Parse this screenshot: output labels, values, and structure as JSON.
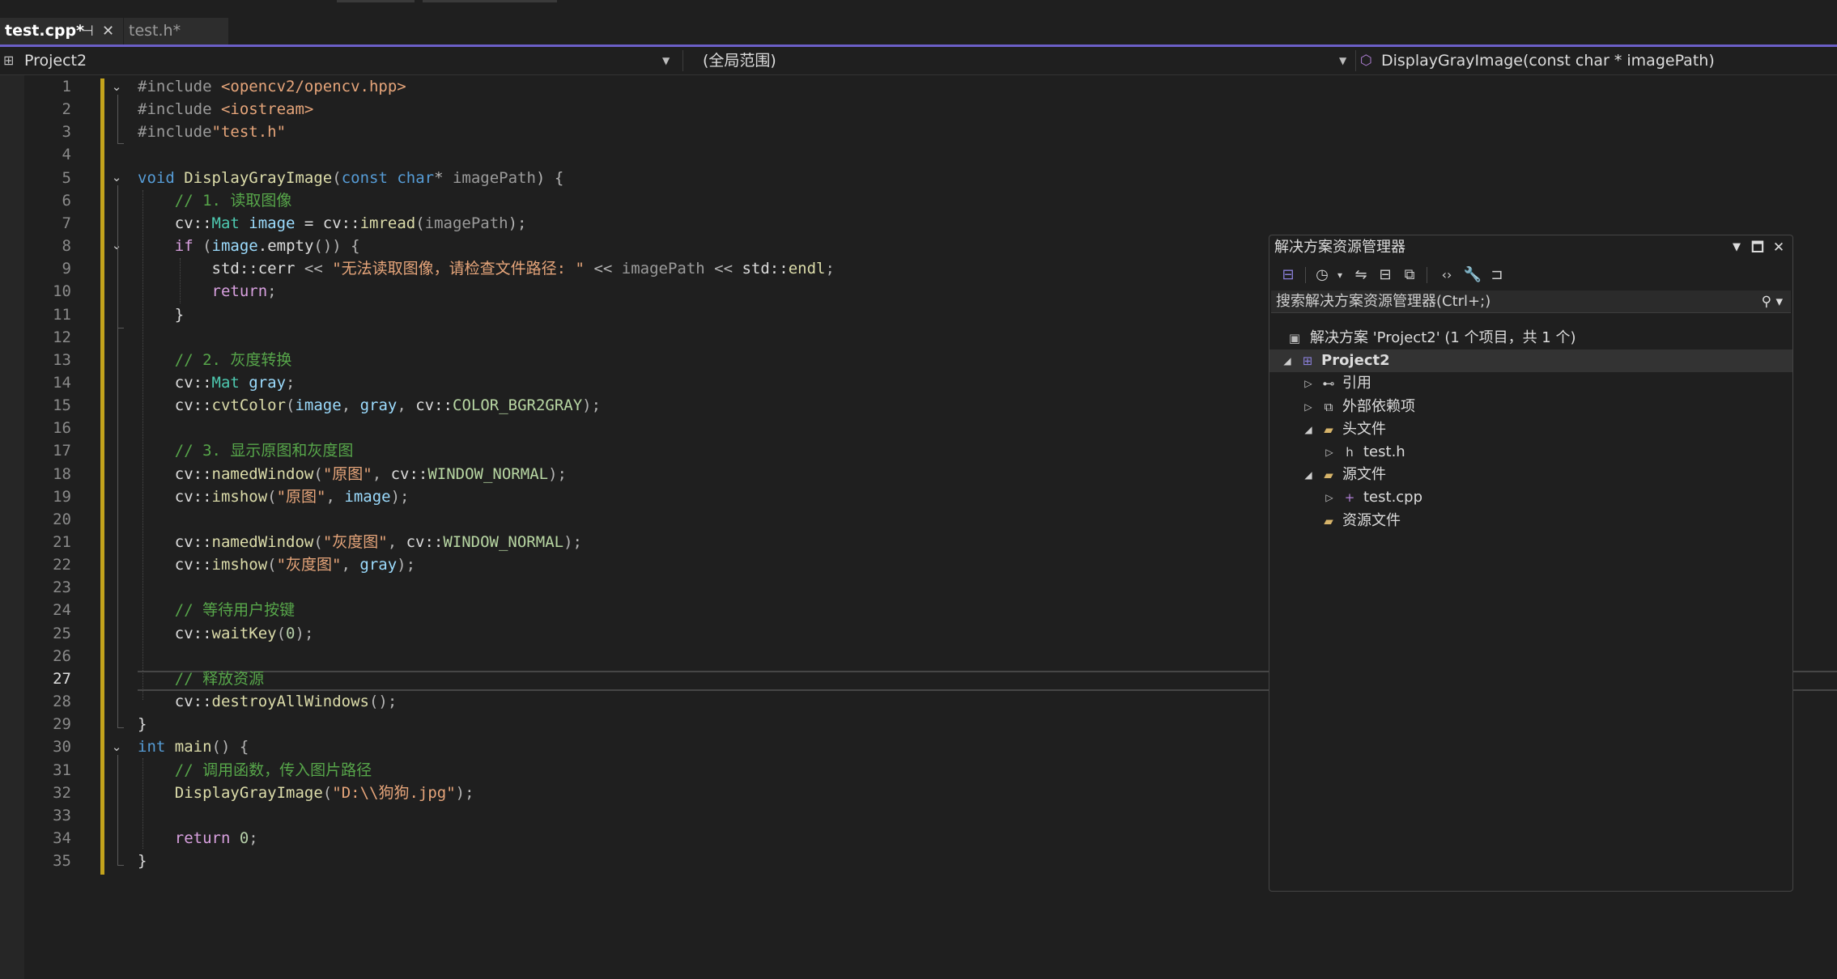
{
  "tabs": [
    {
      "label": "test.cpp*",
      "pin_icon": "⊣",
      "close_icon": "✕",
      "active": true
    },
    {
      "label": "test.h*",
      "active": false
    }
  ],
  "navbar": {
    "project": "Project2",
    "scope": "(全局范围)",
    "member": "DisplayGrayImage(const char * imagePath)"
  },
  "editor": {
    "current_line": 27,
    "lines": [
      {
        "n": 1,
        "tokens": [
          [
            "pre",
            "#include "
          ],
          [
            "str",
            "<opencv2/opencv.hpp>"
          ]
        ]
      },
      {
        "n": 2,
        "tokens": [
          [
            "pre",
            "#include "
          ],
          [
            "str",
            "<iostream>"
          ]
        ]
      },
      {
        "n": 3,
        "tokens": [
          [
            "pre",
            "#include"
          ],
          [
            "str",
            "\"test.h\""
          ]
        ]
      },
      {
        "n": 4,
        "tokens": []
      },
      {
        "n": 5,
        "tokens": [
          [
            "kw",
            "void "
          ],
          [
            "fn",
            "DisplayGrayImage"
          ],
          [
            "op",
            "("
          ],
          [
            "kw",
            "const "
          ],
          [
            "kw",
            "char"
          ],
          [
            "op",
            "* "
          ],
          [
            "pre",
            "imagePath"
          ],
          [
            "op",
            ") {"
          ]
        ]
      },
      {
        "n": 6,
        "tokens": [
          [
            "",
            "    "
          ],
          [
            "com",
            "// 1. 读取图像"
          ]
        ]
      },
      {
        "n": 7,
        "tokens": [
          [
            "",
            "    cv::"
          ],
          [
            "type",
            "Mat "
          ],
          [
            "var",
            "image"
          ],
          [
            "",
            " = cv::"
          ],
          [
            "fn",
            "imread"
          ],
          [
            "op",
            "("
          ],
          [
            "pre",
            "imagePath"
          ],
          [
            "op",
            ");"
          ]
        ]
      },
      {
        "n": 8,
        "tokens": [
          [
            "",
            "    "
          ],
          [
            "kw2",
            "if "
          ],
          [
            "op",
            "("
          ],
          [
            "var",
            "image"
          ],
          [
            "",
            ".empty"
          ],
          [
            "op",
            "()) {"
          ]
        ]
      },
      {
        "n": 9,
        "tokens": [
          [
            "",
            "        std::cerr "
          ],
          [
            "op",
            "<< "
          ],
          [
            "str",
            "\"无法读取图像，请检查文件路径: \""
          ],
          [
            "op",
            " << "
          ],
          [
            "pre",
            "imagePath"
          ],
          [
            "op",
            " << "
          ],
          [
            "",
            "std::"
          ],
          [
            "fn",
            "endl"
          ],
          [
            "op",
            ";"
          ]
        ]
      },
      {
        "n": 10,
        "tokens": [
          [
            "",
            "        "
          ],
          [
            "kw2",
            "return"
          ],
          [
            "op",
            ";"
          ]
        ]
      },
      {
        "n": 11,
        "tokens": [
          [
            "",
            "    }"
          ]
        ]
      },
      {
        "n": 12,
        "tokens": []
      },
      {
        "n": 13,
        "tokens": [
          [
            "",
            "    "
          ],
          [
            "com",
            "// 2. 灰度转换"
          ]
        ]
      },
      {
        "n": 14,
        "tokens": [
          [
            "",
            "    cv::"
          ],
          [
            "type",
            "Mat "
          ],
          [
            "var",
            "gray"
          ],
          [
            "op",
            ";"
          ]
        ]
      },
      {
        "n": 15,
        "tokens": [
          [
            "",
            "    cv::"
          ],
          [
            "fn",
            "cvtColor"
          ],
          [
            "op",
            "("
          ],
          [
            "var",
            "image"
          ],
          [
            "op",
            ", "
          ],
          [
            "var",
            "gray"
          ],
          [
            "op",
            ", "
          ],
          [
            "",
            "cv::"
          ],
          [
            "enum",
            "COLOR_BGR2GRAY"
          ],
          [
            "op",
            ");"
          ]
        ]
      },
      {
        "n": 16,
        "tokens": []
      },
      {
        "n": 17,
        "tokens": [
          [
            "",
            "    "
          ],
          [
            "com",
            "// 3. 显示原图和灰度图"
          ]
        ]
      },
      {
        "n": 18,
        "tokens": [
          [
            "",
            "    cv::"
          ],
          [
            "fn",
            "namedWindow"
          ],
          [
            "op",
            "("
          ],
          [
            "str",
            "\"原图\""
          ],
          [
            "op",
            ", "
          ],
          [
            "",
            "cv::"
          ],
          [
            "enum",
            "WINDOW_NORMAL"
          ],
          [
            "op",
            ");"
          ]
        ]
      },
      {
        "n": 19,
        "tokens": [
          [
            "",
            "    cv::"
          ],
          [
            "fn",
            "imshow"
          ],
          [
            "op",
            "("
          ],
          [
            "str",
            "\"原图\""
          ],
          [
            "op",
            ", "
          ],
          [
            "var",
            "image"
          ],
          [
            "op",
            ");"
          ]
        ]
      },
      {
        "n": 20,
        "tokens": []
      },
      {
        "n": 21,
        "tokens": [
          [
            "",
            "    cv::"
          ],
          [
            "fn",
            "namedWindow"
          ],
          [
            "op",
            "("
          ],
          [
            "str",
            "\"灰度图\""
          ],
          [
            "op",
            ", "
          ],
          [
            "",
            "cv::"
          ],
          [
            "enum",
            "WINDOW_NORMAL"
          ],
          [
            "op",
            ");"
          ]
        ]
      },
      {
        "n": 22,
        "tokens": [
          [
            "",
            "    cv::"
          ],
          [
            "fn",
            "imshow"
          ],
          [
            "op",
            "("
          ],
          [
            "str",
            "\"灰度图\""
          ],
          [
            "op",
            ", "
          ],
          [
            "var",
            "gray"
          ],
          [
            "op",
            ");"
          ]
        ]
      },
      {
        "n": 23,
        "tokens": []
      },
      {
        "n": 24,
        "tokens": [
          [
            "",
            "    "
          ],
          [
            "com",
            "// 等待用户按键"
          ]
        ]
      },
      {
        "n": 25,
        "tokens": [
          [
            "",
            "    cv::"
          ],
          [
            "fn",
            "waitKey"
          ],
          [
            "op",
            "("
          ],
          [
            "num",
            "0"
          ],
          [
            "op",
            ");"
          ]
        ]
      },
      {
        "n": 26,
        "tokens": []
      },
      {
        "n": 27,
        "tokens": [
          [
            "",
            "    "
          ],
          [
            "com",
            "// 释放资源"
          ]
        ]
      },
      {
        "n": 28,
        "tokens": [
          [
            "",
            "    cv::"
          ],
          [
            "fn",
            "destroyAllWindows"
          ],
          [
            "op",
            "();"
          ]
        ]
      },
      {
        "n": 29,
        "tokens": [
          [
            "",
            "}"
          ]
        ]
      },
      {
        "n": 30,
        "tokens": [
          [
            "kw",
            "int "
          ],
          [
            "fn",
            "main"
          ],
          [
            "op",
            "() {"
          ]
        ]
      },
      {
        "n": 31,
        "tokens": [
          [
            "",
            "    "
          ],
          [
            "com",
            "// 调用函数，传入图片路径"
          ]
        ]
      },
      {
        "n": 32,
        "tokens": [
          [
            "",
            "    "
          ],
          [
            "fn",
            "DisplayGrayImage"
          ],
          [
            "op",
            "("
          ],
          [
            "str",
            "\"D:\\\\狗狗.jpg\""
          ],
          [
            "op",
            ");"
          ]
        ]
      },
      {
        "n": 33,
        "tokens": []
      },
      {
        "n": 34,
        "tokens": [
          [
            "",
            "    "
          ],
          [
            "kw2",
            "return "
          ],
          [
            "num",
            "0"
          ],
          [
            "op",
            ";"
          ]
        ]
      },
      {
        "n": 35,
        "tokens": [
          [
            "",
            "}"
          ]
        ]
      }
    ]
  },
  "solution_explorer": {
    "title": "解决方案资源管理器",
    "search_placeholder": "搜索解决方案资源管理器(Ctrl+;)",
    "tree": [
      {
        "label": "解决方案 'Project2' (1 个项目，共 1 个)",
        "icon": "solution-icon",
        "glyph": "▣",
        "level": 0,
        "expander": "",
        "bold": false,
        "selected": false
      },
      {
        "label": "Project2",
        "icon": "project-icon",
        "glyph": "⊞",
        "level": 1,
        "expander": "◢",
        "bold": true,
        "selected": true
      },
      {
        "label": "引用",
        "icon": "references-icon",
        "glyph": "⊷",
        "level": 2,
        "expander": "▷",
        "bold": false,
        "selected": false
      },
      {
        "label": "外部依赖项",
        "icon": "external-deps-icon",
        "glyph": "⧉",
        "level": 2,
        "expander": "▷",
        "bold": false,
        "selected": false
      },
      {
        "label": "头文件",
        "icon": "folder-filter-icon",
        "glyph": "▰",
        "level": 2,
        "expander": "◢",
        "bold": false,
        "selected": false
      },
      {
        "label": "test.h",
        "icon": "header-file-icon",
        "glyph": "h",
        "level": 3,
        "expander": "▷",
        "bold": false,
        "selected": false
      },
      {
        "label": "源文件",
        "icon": "folder-filter-icon",
        "glyph": "▰",
        "level": 2,
        "expander": "◢",
        "bold": false,
        "selected": false
      },
      {
        "label": "test.cpp",
        "icon": "cpp-file-icon",
        "glyph": "+",
        "level": 3,
        "expander": "▷",
        "bold": false,
        "selected": false
      },
      {
        "label": "资源文件",
        "icon": "folder-filter-icon",
        "glyph": "▰",
        "level": 2,
        "expander": "",
        "bold": false,
        "selected": false
      }
    ]
  },
  "colors": {
    "accent": "#6b5fc7",
    "change_marker": "#c3a31c",
    "folder": "#d7b46a",
    "project": "#8a7fd8"
  }
}
